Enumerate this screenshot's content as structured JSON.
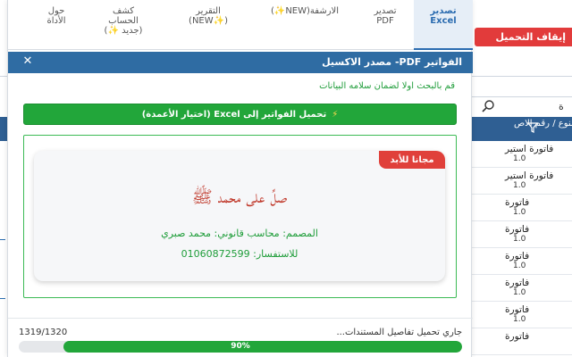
{
  "background": {
    "stop_button": "إيقاف التحميل",
    "search_text": "ة",
    "table_header": "النوع / رقم الاص",
    "rows": [
      {
        "title": "فاتورة استير",
        "sub": "1.0"
      },
      {
        "title": "فاتورة استير",
        "sub": "1.0"
      },
      {
        "title": "فاتورة",
        "sub": "1.0"
      },
      {
        "title": "فاتورة",
        "sub": "1.0"
      },
      {
        "title": "فاتورة",
        "sub": "1.0"
      },
      {
        "title": "فاتورة",
        "sub": "1.0"
      },
      {
        "title": "فاتورة",
        "sub": "1.0"
      },
      {
        "title": "فاتورة",
        "sub": ""
      }
    ]
  },
  "tabs": [
    {
      "line1": "تصدير",
      "line2": "Excel",
      "line3": "",
      "active": true
    },
    {
      "line1": "تصدير",
      "line2": "PDF",
      "line3": "",
      "active": false
    },
    {
      "line1": "الارشفة(NEW",
      "star": "✨",
      "line2": ")",
      "line3": "",
      "active": false
    },
    {
      "line1": "التقرير",
      "line2": "(✨NEW)",
      "line3": "",
      "active": false
    },
    {
      "line1": "كشف",
      "line2": "الحساب",
      "line3": "(جديد ✨)",
      "active": false
    },
    {
      "line1": "حول",
      "line2": "الأداة",
      "line3": "",
      "active": false
    }
  ],
  "header": {
    "title": "مصدر الاكسيل -PDF الفواتير",
    "close": "✕"
  },
  "hint": "قم بالبحث اولا لضمان سلامه البيانات",
  "load_button": {
    "icon": "⚡",
    "label": "تحميل الفواتير إلى Excel (اختيار الأعمدة)"
  },
  "card": {
    "ribbon": "مجانا للأبد",
    "prayer": "صلِّ على محمد ﷺ",
    "designer": "المصمم: محاسب قانوني: محمد صبري",
    "contact": "للاستفسار: 01060872599"
  },
  "status": {
    "text": "جاري تحميل تفاصيل المستندات...",
    "count": "1319/1320",
    "percent_label": "90%",
    "percent": 90
  },
  "colors": {
    "accent": "#2f6ca3",
    "success": "#22a63a",
    "danger": "#e0403a"
  }
}
